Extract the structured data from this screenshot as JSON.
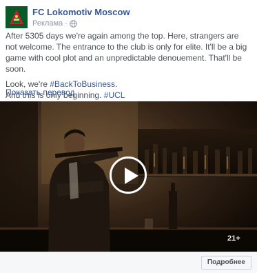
{
  "header": {
    "page_name": "FC Lokomotiv Moscow",
    "sponsored_label": "Реклама",
    "separator": "·",
    "privacy_icon": "globe-icon"
  },
  "post": {
    "paragraph1": "After 5305 days we're again among the top. Here, strangers are not welcome. The entrance to the club is only for elite. It'll be a big game with cool plot and an unpredictable denouement. That'll be soon.",
    "line2_prefix": "Look, we're ",
    "hashtag_back": "#BackToBusiness",
    "line2_suffix": ".",
    "line3_prefix": "And this is only beginning. ",
    "hashtag_ucl": "#UCL",
    "translate_link": "Показать перевод"
  },
  "video": {
    "play_icon": "play-icon",
    "age_rating": "21+"
  },
  "footer": {
    "cta_label": "Подробнее"
  },
  "colors": {
    "link": "#365899",
    "text": "#4b4f56",
    "meta": "#90949c",
    "brand_green": "#0b6b2e"
  }
}
